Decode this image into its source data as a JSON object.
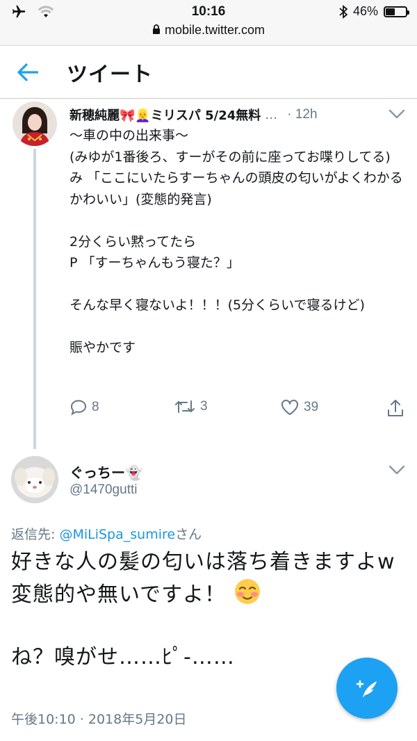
{
  "status_bar": {
    "time": "10:16",
    "battery": "46%",
    "battery_level": 0.46,
    "url": "mobile.twitter.com"
  },
  "header": {
    "title": "ツイート"
  },
  "tweet1": {
    "name": "新穂純麗🎀👱‍♀️ミリスパ 5/24無料",
    "ellipsis": "…",
    "time": "· 12h",
    "body": "〜車の中の出来事〜\n(みゆが1番後ろ、すーがその前に座ってお喋りしてる)\nみ 「ここにいたらすーちゃんの頭皮の匂いがよくわかるかわいい」(変態的発言)\n\n2分くらい黙ってたら\nP 「すーちゃんもう寝た？」\n\nそんな早く寝ないよ！！！(5分くらいで寝るけど)\n\n賑やかです",
    "replies": "8",
    "retweets": "3",
    "likes": "39"
  },
  "tweet2": {
    "name": "ぐっちー👻",
    "handle": "@1470gutti",
    "reply_prefix": "返信先: ",
    "reply_mention": "@MiLiSpa_sumire",
    "reply_suffix": "さん",
    "body_line1": "好きな人の髪の匂いは落ち着きますよw",
    "body_line2": "変態的や無いですよ！",
    "body_line3": "\nね？嗅がせ……ﾋﾟ-……",
    "date": "午後10:10 · 2018年5月20日"
  },
  "colors": {
    "accent": "#1da1f2",
    "link": "#1b95e0",
    "muted": "#657786"
  },
  "icons": [
    "airplane-icon",
    "wifi-icon",
    "bluetooth-icon",
    "battery-icon",
    "lock-icon",
    "back-arrow-icon",
    "chevron-down-icon",
    "reply-icon",
    "retweet-icon",
    "like-icon",
    "share-icon",
    "compose-icon"
  ]
}
